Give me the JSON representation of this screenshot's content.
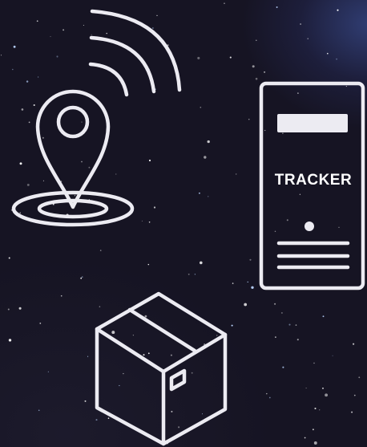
{
  "tracker": {
    "label": "TRACKER"
  },
  "icons": {
    "location": "location-pin-wifi-icon",
    "server": "server-tower-icon",
    "package": "package-box-icon"
  },
  "colors": {
    "background": "#161423",
    "line_art": "#ecebf2",
    "glow": "#465fb4"
  }
}
